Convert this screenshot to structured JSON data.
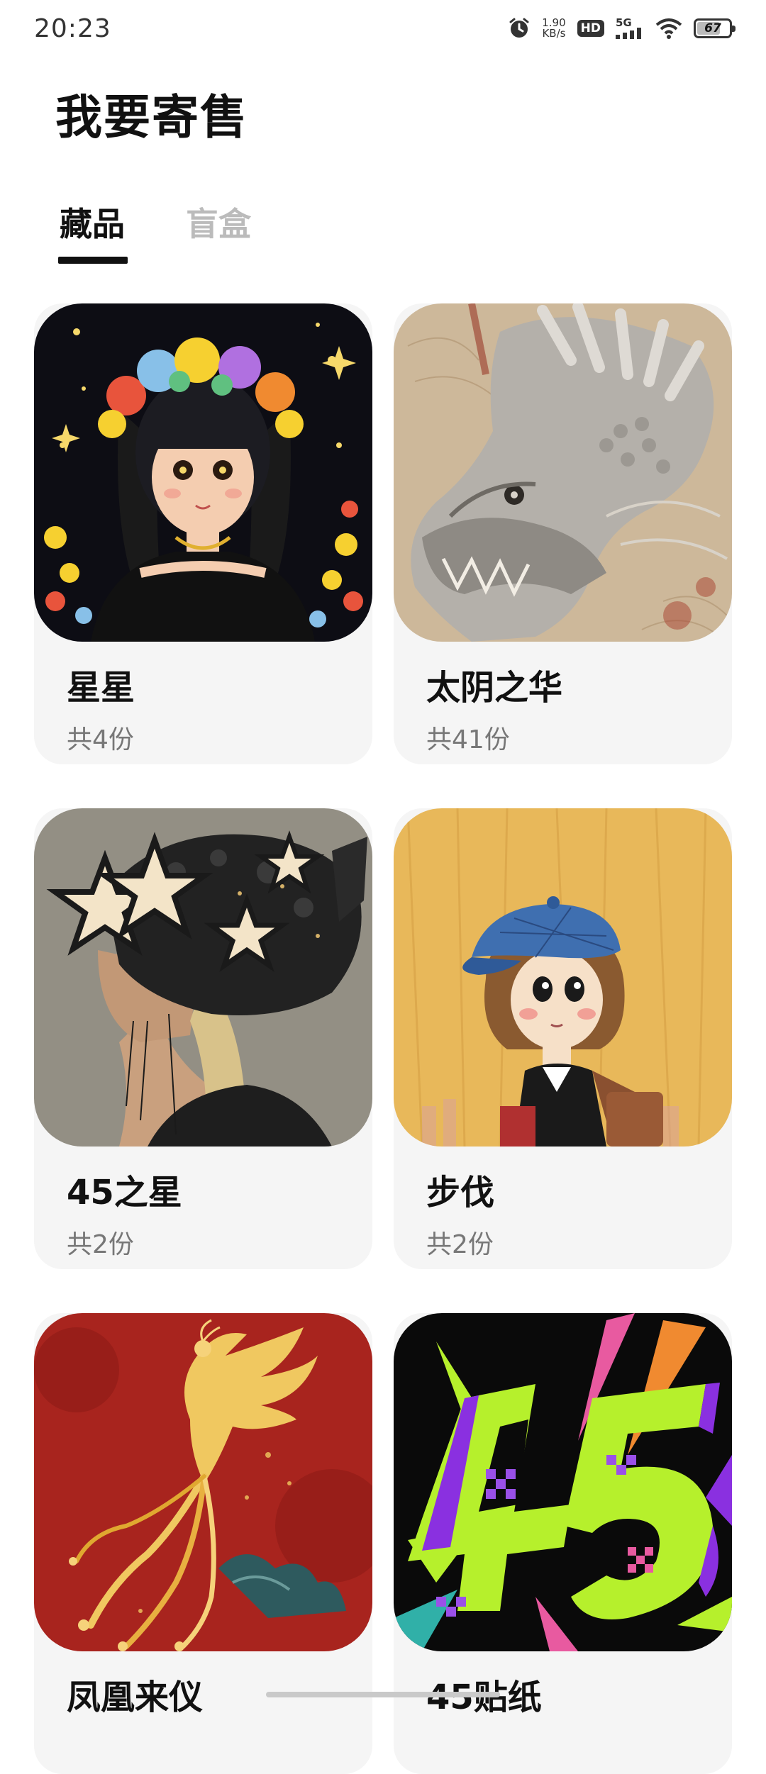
{
  "status_bar": {
    "time": "20:23",
    "net_speed_value": "1.90",
    "net_speed_unit": "KB/s",
    "hd_label": "HD",
    "network_label": "5G",
    "battery_level": "67",
    "icons": [
      "alarm-icon",
      "hd-icon",
      "signal-icon",
      "wifi-icon",
      "battery-icon"
    ]
  },
  "header": {
    "title": "我要寄售"
  },
  "tabs": [
    {
      "label": "藏品",
      "active": true
    },
    {
      "label": "盲盒",
      "active": false
    }
  ],
  "items": [
    {
      "name": "星星",
      "count": "共4份"
    },
    {
      "name": "太阴之华",
      "count": "共41份"
    },
    {
      "name": "45之星",
      "count": "共2份"
    },
    {
      "name": "步伐",
      "count": "共2份"
    },
    {
      "name": "凤凰来仪",
      "count": ""
    },
    {
      "name": "45贴纸",
      "count": ""
    }
  ],
  "colors": {
    "accent": "#111111",
    "tab_inactive": "#bbbbbb",
    "card_bg": "#f5f5f5",
    "muted_text": "#777777"
  }
}
